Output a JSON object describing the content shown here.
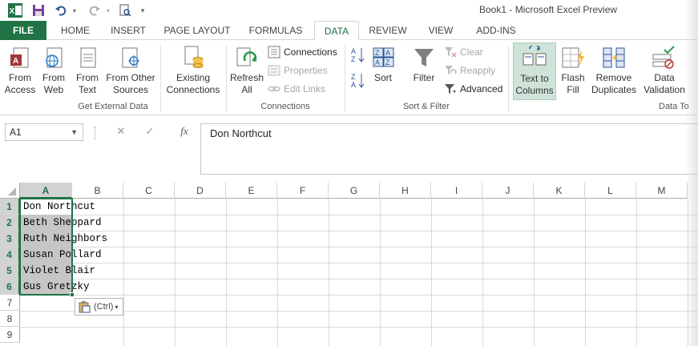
{
  "window": {
    "title": "Book1 - Microsoft Excel Preview"
  },
  "tabs": [
    {
      "label": "FILE"
    },
    {
      "label": "HOME"
    },
    {
      "label": "INSERT"
    },
    {
      "label": "PAGE LAYOUT"
    },
    {
      "label": "FORMULAS"
    },
    {
      "label": "DATA"
    },
    {
      "label": "REVIEW"
    },
    {
      "label": "VIEW"
    },
    {
      "label": "ADD-INS"
    }
  ],
  "ribbon": {
    "get_external": {
      "from_access": "From\nAccess",
      "from_web": "From\nWeb",
      "from_text": "From\nText",
      "from_other": "From Other\nSources",
      "existing": "Existing\nConnections",
      "group_label": "Get External Data"
    },
    "connections": {
      "refresh": "Refresh\nAll",
      "connections": "Connections",
      "properties": "Properties",
      "edit_links": "Edit Links",
      "group_label": "Connections"
    },
    "sort_filter": {
      "sort": "Sort",
      "filter": "Filter",
      "clear": "Clear",
      "reapply": "Reapply",
      "advanced": "Advanced",
      "group_label": "Sort & Filter"
    },
    "data_tools": {
      "text_to_columns": "Text to\nColumns",
      "flash_fill": "Flash\nFill",
      "remove_duplicates": "Remove\nDuplicates",
      "data_validation": "Data\nValidation",
      "group_label": "Data To"
    }
  },
  "formula_bar": {
    "name_box": "A1",
    "cancel_symbol": "✕",
    "enter_symbol": "✓",
    "fx_symbol": "fx",
    "content": "Don Northcut"
  },
  "grid": {
    "columns": [
      "A",
      "B",
      "C",
      "D",
      "E",
      "F",
      "G",
      "H",
      "I",
      "J",
      "K",
      "L",
      "M"
    ],
    "rows": [
      "1",
      "2",
      "3",
      "4",
      "5",
      "6",
      "7",
      "8",
      "9"
    ],
    "cells": [
      "Don Northcut",
      "Beth Sheppard",
      "Ruth Neighbors",
      "Susan Pollard",
      "Violet Blair",
      "Gus Gretzky"
    ]
  },
  "paste_options": {
    "label": "(Ctrl)"
  },
  "colors": {
    "accent": "#217346",
    "selection": "#c6c6c6"
  },
  "icons": {
    "app": "excel-icon",
    "save": "save-icon",
    "undo": "undo-icon",
    "redo": "redo-icon",
    "preview": "print-preview-icon"
  }
}
